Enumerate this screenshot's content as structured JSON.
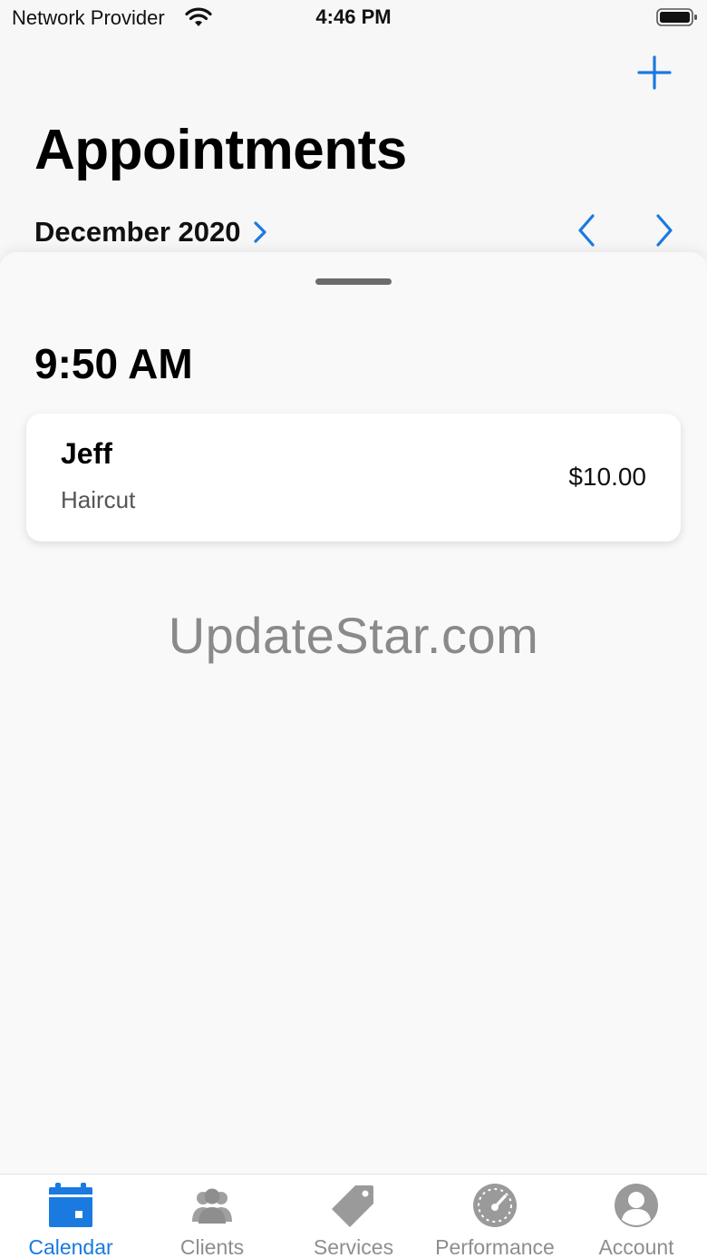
{
  "status_bar": {
    "carrier": "Network Provider",
    "time": "4:46 PM"
  },
  "header": {
    "title": "Appointments",
    "month": "December 2020"
  },
  "schedule": {
    "time_slot": "9:50 AM",
    "appointment": {
      "client": "Jeff",
      "service": "Haircut",
      "price": "$10.00"
    }
  },
  "watermark": "UpdateStar.com",
  "tabs": [
    {
      "label": "Calendar",
      "icon": "calendar-icon",
      "active": true
    },
    {
      "label": "Clients",
      "icon": "clients-icon",
      "active": false
    },
    {
      "label": "Services",
      "icon": "tag-icon",
      "active": false
    },
    {
      "label": "Performance",
      "icon": "speedometer-icon",
      "active": false
    },
    {
      "label": "Account",
      "icon": "account-icon",
      "active": false
    }
  ],
  "colors": {
    "accent": "#1a7ae0",
    "inactive": "#8e8e8e",
    "background": "#f7f7f7"
  }
}
